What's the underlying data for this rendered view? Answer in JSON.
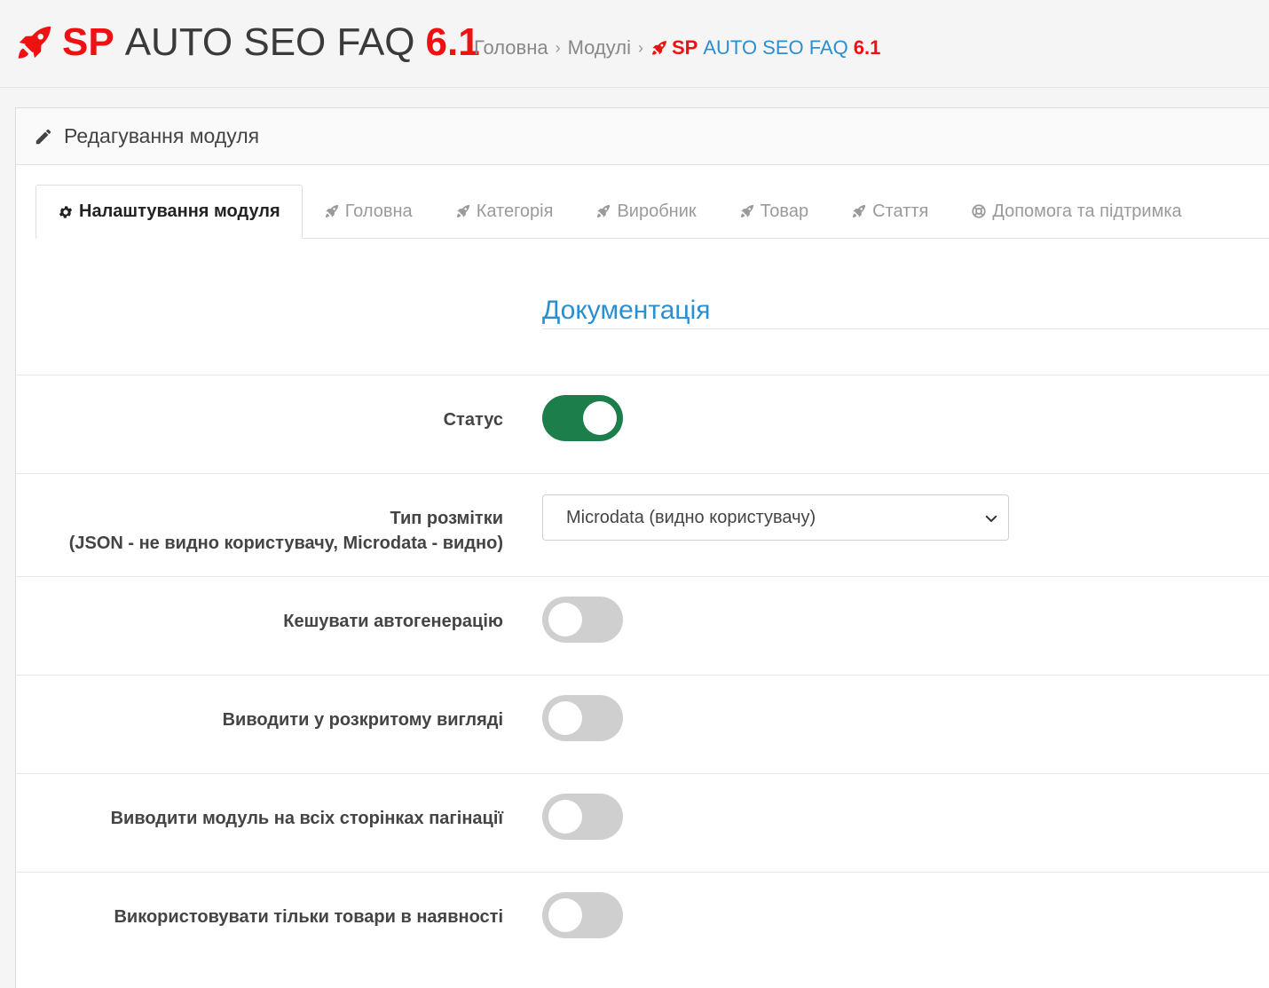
{
  "header": {
    "title_sp": "SP",
    "title_main": "AUTO SEO FAQ",
    "title_version": "6.1",
    "breadcrumb": {
      "home": "Головна",
      "modules": "Модулі",
      "separator": "›",
      "current_sp": "SP",
      "current_main": "AUTO SEO FAQ",
      "current_version": "6.1"
    }
  },
  "panel": {
    "heading": "Редагування модуля",
    "icon": "pencil-icon"
  },
  "tabs": [
    {
      "label": "Налаштування модуля",
      "icon": "gear-icon",
      "active": true
    },
    {
      "label": "Головна",
      "icon": "rocket-icon",
      "active": false
    },
    {
      "label": "Категорія",
      "icon": "rocket-icon",
      "active": false
    },
    {
      "label": "Виробник",
      "icon": "rocket-icon",
      "active": false
    },
    {
      "label": "Товар",
      "icon": "rocket-icon",
      "active": false
    },
    {
      "label": "Стаття",
      "icon": "rocket-icon",
      "active": false
    },
    {
      "label": "Допомога та підтримка",
      "icon": "life-ring-icon",
      "active": false
    }
  ],
  "documentation_link": "Документація",
  "form": {
    "status": {
      "label": "Статус",
      "on": true
    },
    "markup_type": {
      "label_line1": "Тип розмітки",
      "label_line2": "(JSON - не видно користувачу, Microdata - видно)",
      "selected": "Microdata (видно користувачу)"
    },
    "cache_autogen": {
      "label": "Кешувати автогенерацію",
      "on": false
    },
    "expanded_view": {
      "label": "Виводити у розкритому вигляді",
      "on": false
    },
    "all_pagination": {
      "label": "Виводити модуль на всіх сторінках пагінації",
      "on": false
    },
    "in_stock_only": {
      "label": "Використовувати тільки товари в наявності",
      "on": false
    }
  },
  "colors": {
    "brand_red": "#ef1111",
    "link_blue": "#2a8fd0",
    "switch_on": "#1b7e4b",
    "switch_off": "#cfcfcf"
  }
}
